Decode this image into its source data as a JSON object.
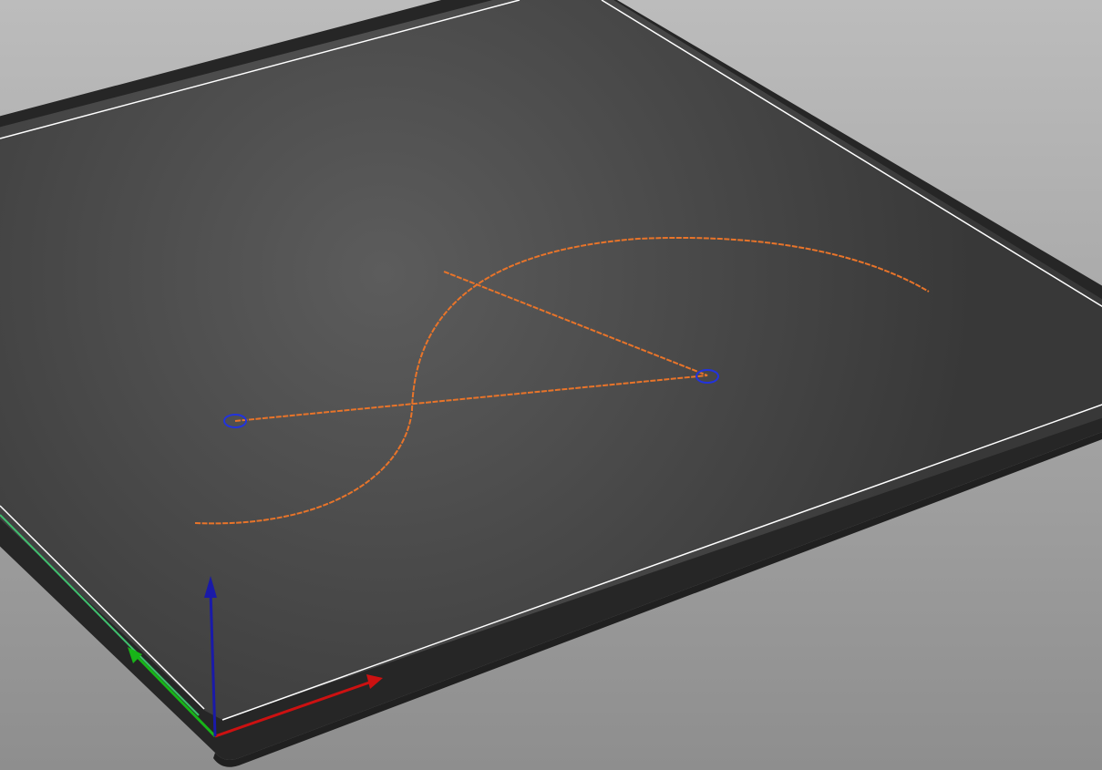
{
  "viewport": {
    "background_top": "#bcbcbc",
    "background_bottom": "#8e8e8e"
  },
  "colors": {
    "plate_surface_center": "#5c5c5c",
    "plate_surface_edge": "#383838",
    "plate_side": "#262626",
    "plate_rim": "#ffffff",
    "path": "#e8742a",
    "marker": "#2233dd",
    "axis_x": "#cc1111",
    "axis_y": "#18b418",
    "axis_z": "#1a1aa8",
    "plate_edge_highlight": "#3fbf6e"
  },
  "scene_objects": {
    "build_plate": "build-plate",
    "s_curve": "s-curve-path",
    "straight_path": "straight-line-path",
    "markers": [
      "path-endpoint-marker",
      "path-endpoint-marker"
    ],
    "axes": [
      "x-axis-arrow",
      "y-axis-arrow",
      "z-axis-arrow"
    ]
  }
}
